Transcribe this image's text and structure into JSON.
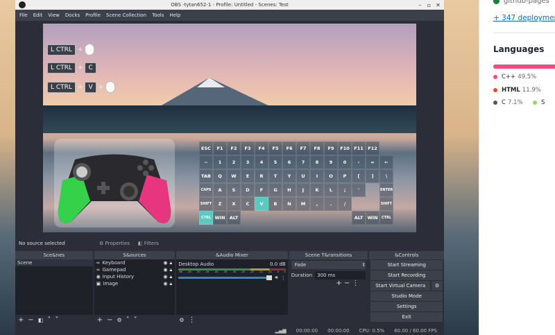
{
  "window": {
    "title": "OBS -tytan652-1 - Profile: Untitled - Scenes: Test"
  },
  "menu": [
    "File",
    "Edit",
    "View",
    "Docks",
    "Profile",
    "Scene Collection",
    "Tools",
    "Help"
  ],
  "overlay": {
    "shortcuts": [
      [
        "L CTRL",
        "+",
        "mouse"
      ],
      [
        "L CTRL",
        "+",
        "C"
      ],
      [
        "L CTRL",
        "+",
        "V",
        "+",
        "mouse"
      ]
    ]
  },
  "keyboard": {
    "highlight_color": "#5cc8c0",
    "pressed": [
      "V",
      "CTRL"
    ],
    "rows": [
      [
        "ESC",
        "F1",
        "F2",
        "F3",
        "F4",
        "F5",
        "F6",
        "F7",
        "F8",
        "F9",
        "F10",
        "F11",
        "F12",
        null
      ],
      [
        "~",
        "1",
        "2",
        "3",
        "4",
        "5",
        "6",
        "7",
        "8",
        "9",
        "0",
        "-",
        "=",
        "←"
      ],
      [
        "TAB",
        "Q",
        "W",
        "E",
        "R",
        "T",
        "Y",
        "U",
        "I",
        "O",
        "P",
        "[",
        "]",
        "\\"
      ],
      [
        "CAPS",
        "A",
        "S",
        "D",
        "F",
        "G",
        "H",
        "J",
        "K",
        "L",
        ";",
        "'",
        null,
        "ENTER"
      ],
      [
        "SHIFT",
        "Z",
        "X",
        "C",
        "V",
        "B",
        "N",
        "M",
        ",",
        ".",
        "/",
        null,
        null,
        "SHIFT"
      ],
      [
        "CTRL",
        "WIN",
        "ALT",
        null,
        null,
        null,
        null,
        null,
        null,
        null,
        null,
        "ALT",
        "WIN",
        "CTRL"
      ]
    ]
  },
  "source_bar": {
    "status": "No source selected",
    "properties": "Properties",
    "filters": "Filters"
  },
  "scenes": {
    "title": "Sce&nes",
    "items": [
      "Scene"
    ]
  },
  "sources": {
    "title": "S&ources",
    "items": [
      {
        "name": "Keyboard",
        "icon": "gamepad-icon"
      },
      {
        "name": "Gamepad",
        "icon": "gamepad-icon"
      },
      {
        "name": "Input History",
        "icon": "globe-icon"
      },
      {
        "name": "Image",
        "icon": "image-icon"
      }
    ]
  },
  "mixer": {
    "title": "&Audio Mixer",
    "channel": "Desktop Audio",
    "level": "0.0 dB",
    "ticks": [
      "-60",
      "-55",
      "-50",
      "-45",
      "-40",
      "-35",
      "-30",
      "-25",
      "-20",
      "-15",
      "-10",
      "-5",
      "0"
    ],
    "volume_percent": 100
  },
  "transitions": {
    "title": "Scene T&ransitions",
    "type": "Fade",
    "duration_label": "Duration",
    "duration": "300 ms"
  },
  "controls": {
    "title": "&Controls",
    "buttons": [
      "Start Streaming",
      "Start Recording",
      "Start Virtual Camera",
      "Studio Mode",
      "Settings",
      "Exit"
    ]
  },
  "status": {
    "stream_time": "00:00:00",
    "rec_time": "00:00:00",
    "cpu": "CPU: 0.5%",
    "fps": "60.00 / 60.00 FPS"
  },
  "github": {
    "deploy_name": "github-pages",
    "deployments": "+ 347 deployments",
    "languages_title": "Languages",
    "languages": [
      {
        "name": "C++",
        "pct": "49.5%",
        "color": "#f34b7d"
      },
      {
        "name": "HTML",
        "pct": "11.9%",
        "color": "#e34c26"
      },
      {
        "name": "C",
        "pct": "7.1%",
        "color": "#555555"
      },
      {
        "name": "S",
        "pct": "",
        "color": "#89e051"
      }
    ]
  }
}
